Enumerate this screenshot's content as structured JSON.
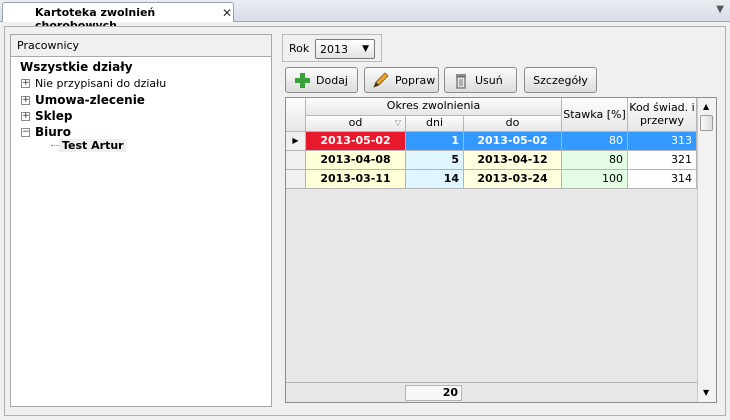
{
  "tab": {
    "title": "Kartoteka zwolnień chorobowych",
    "close": "✕",
    "menu": "▼"
  },
  "left": {
    "header": "Pracownicy",
    "root": "Wszystkie działy",
    "nodes": [
      {
        "label": "Nie przypisani do działu",
        "bold": false,
        "sign": "+"
      },
      {
        "label": "Umowa-zlecenie",
        "bold": true,
        "sign": "+"
      },
      {
        "label": "Sklep",
        "bold": true,
        "sign": "+"
      },
      {
        "label": "Biuro",
        "bold": true,
        "sign": "−"
      }
    ],
    "leaf": "Test Artur"
  },
  "rok": {
    "label": "Rok",
    "value": "2013",
    "arrow": "▼"
  },
  "toolbar": {
    "add": "Dodaj",
    "edit": "Popraw",
    "delete": "Usuń",
    "details": "Szczegóły"
  },
  "table": {
    "group_header": "Okres zwolnienia",
    "columns": {
      "od": "od",
      "dni": "dni",
      "do": "do",
      "stawka": "Stawka [%]",
      "kod": "Kod świad. i przerwy"
    },
    "rows": [
      {
        "od": "2013-05-02",
        "dni": "1",
        "do": "2013-05-02",
        "stawka": "80",
        "kod": "313"
      },
      {
        "od": "2013-04-08",
        "dni": "5",
        "do": "2013-04-12",
        "stawka": "80",
        "kod": "321"
      },
      {
        "od": "2013-03-11",
        "dni": "14",
        "do": "2013-03-24",
        "stawka": "100",
        "kod": "314"
      }
    ],
    "total_dni": "20",
    "row_indicator": "▶"
  },
  "colors": {
    "selected_od": "#e8192c",
    "selected_row": "#3399ff",
    "od_bg": "#ffffd8",
    "dni_bg": "#dff5ff",
    "do_bg": "#ffffe0",
    "stawka_bg": "#e4fce4"
  }
}
